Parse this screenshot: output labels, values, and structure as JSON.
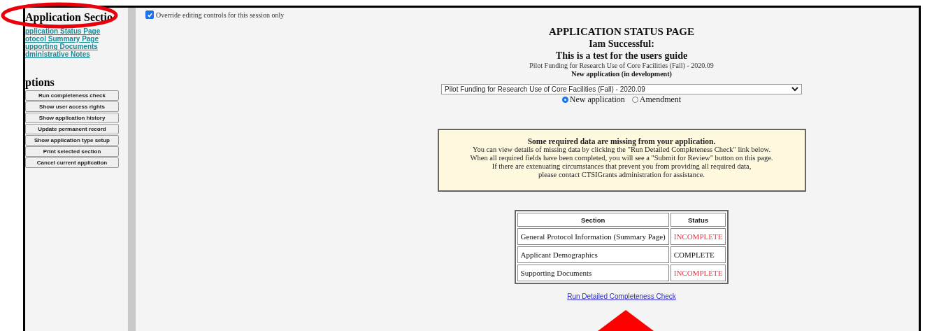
{
  "sidebar": {
    "sections_heading": "Application Sectio",
    "links": [
      "pplication Status Page",
      "otocol Summary Page",
      "upporting Documents",
      "dministrative Notes"
    ],
    "options_heading": "ptions",
    "buttons": [
      "Run completeness check",
      "Show user access rights",
      "Show application history",
      "Update permanent record",
      "Show application type setup",
      "Print selected section",
      "Cancel current application"
    ]
  },
  "override": {
    "label": "Override editing controls for this session only",
    "checked": true
  },
  "header": {
    "title": "APPLICATION STATUS PAGE",
    "name": "Iam Successful:",
    "subtitle": "This is a test for the users guide",
    "program": "Pilot Funding for Research Use of Core Facilities (Fall) - 2020.09",
    "state": "New application (in development)"
  },
  "program_select": {
    "value": "Pilot Funding for Research Use of Core Facilities (Fall) - 2020.09"
  },
  "application_type": [
    {
      "label": "New application",
      "selected": true
    },
    {
      "label": "Amendment",
      "selected": false
    }
  ],
  "notice": {
    "heading": "Some required data are missing from your application.",
    "lines": [
      "You can view details of missing data by clicking the \"Run Detailed Completeness Check\" link below.",
      "When all required fields have been completed, you will see a \"Submit for Review\" button on this page.",
      "If there are extenuating circumstances that prevent you from providing all required data,",
      "please contact CTSIGrants administration for assistance."
    ]
  },
  "status_table": {
    "columns": [
      "Section",
      "Status"
    ],
    "rows": [
      {
        "section": "General Protocol Information (Summary Page)",
        "status": "INCOMPLETE",
        "complete": false
      },
      {
        "section": "Applicant Demographics",
        "status": "COMPLETE",
        "complete": true
      },
      {
        "section": "Supporting Documents",
        "status": "INCOMPLETE",
        "complete": false
      }
    ]
  },
  "check_link": "Run Detailed Completeness Check",
  "annotations": {
    "ellipse": true,
    "arrow": true
  }
}
